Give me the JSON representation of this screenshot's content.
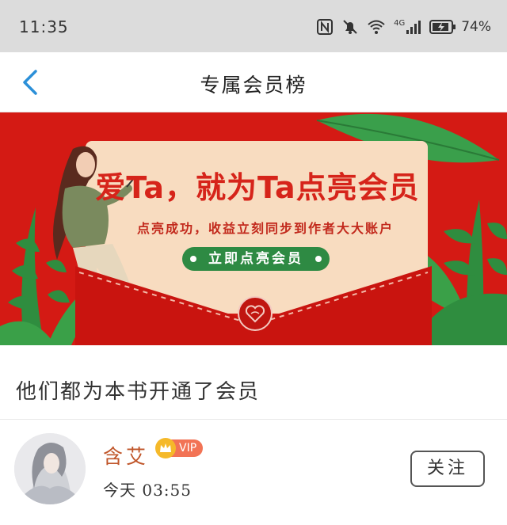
{
  "status_bar": {
    "time": "11:35",
    "network": "4G",
    "battery_percent": "74%"
  },
  "header": {
    "title": "专属会员榜",
    "back_icon": "chevron-left-icon"
  },
  "banner": {
    "headline": "爱Ta，就为Ta点亮会员",
    "subtitle": "点亮成功，收益立刻同步到作者大大账户",
    "cta_label": "立即点亮会员",
    "colors": {
      "background": "#d41a14",
      "card": "#f8dcc0",
      "cta": "#2e8a43"
    }
  },
  "section": {
    "title": "他们都为本书开通了会员"
  },
  "members": [
    {
      "name": "含艾",
      "badge": "VIP",
      "time": "今天 03:55",
      "follow_label": "关注"
    }
  ],
  "colors": {
    "accent_back": "#2b8fd8",
    "name_color": "#c0562a",
    "vip_badge": "#f27355"
  }
}
